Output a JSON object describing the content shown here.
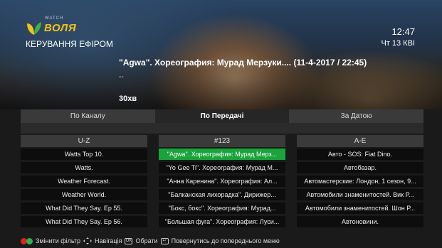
{
  "header": {
    "brand": "ВОЛЯ",
    "brand_small": "WATCH",
    "section_title": "КЕРУВАННЯ ЕФІРОМ",
    "time": "12:47",
    "date": "Чт 13 КВІ"
  },
  "program": {
    "title": "\"Agwa\". Хореография: Мурад Мерзуки.... (11-4-2017 / 22:45)",
    "description": "--",
    "duration": "30хв"
  },
  "tabs": [
    {
      "label": "По Каналу",
      "active": false
    },
    {
      "label": "По Передачі",
      "active": true
    },
    {
      "label": "За Датою",
      "active": false
    }
  ],
  "columns": {
    "left": {
      "header": "U-Z",
      "rows": [
        "Watts Top 10.",
        "Watts.",
        "Weather Forecast.",
        "Weather World.",
        "What Did They Say. Ep 55.",
        "What Did They Say. Ep 56."
      ]
    },
    "middle": {
      "header": "#123",
      "rows": [
        "\"Agwa\". Хореография: Мурад Мерз...",
        "\"Yo Gee Ti\". Хореография: Мурад М...",
        "\"Анна Каренина\". Хореография: Ал...",
        "\"Балканская лихорадка\". Дирижер...",
        "\"Бокс, бокс\". Хореография: Мурад...",
        "\"Большая фуга\". Хореография: Луси..."
      ],
      "selected_index": 0
    },
    "right": {
      "header": "А-Е",
      "rows": [
        "Авто - SOS: Fiat Dino.",
        "Автобазар.",
        "Автомастерские: Лондон, 1 сезон, 9...",
        "Автомобили знаменитостей. Вик Р...",
        "Автомобили знаменитостей. Шон Р...",
        "Автоновини."
      ]
    }
  },
  "footer": {
    "change_filter": "Змінити фільтр",
    "navigation": "Навігація",
    "select": "Обрати",
    "back": "Повернутись до попереднього меню"
  },
  "colors": {
    "selected_row": "#1aa33b",
    "brand_yellow": "#f2c21b"
  }
}
